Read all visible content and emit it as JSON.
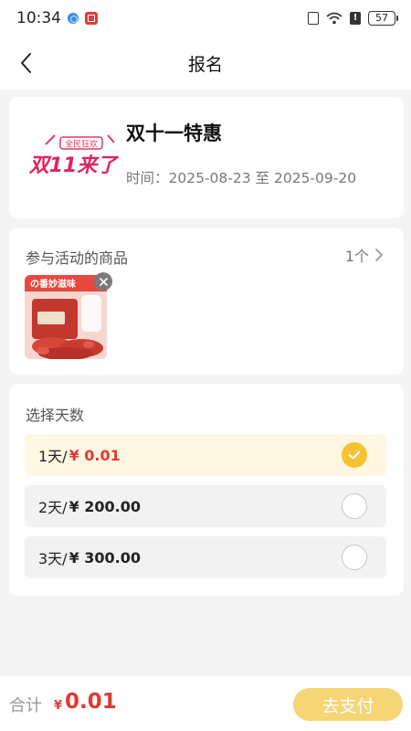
{
  "status_bar": {
    "time": "10:34",
    "battery": "57"
  },
  "nav": {
    "title": "报名"
  },
  "event": {
    "logo_text": "双11来了",
    "logo_badge": "全民狂欢",
    "title": "双十一特惠",
    "time_label": "时间：",
    "start_date": "2025-08-23",
    "to": "至",
    "end_date": "2025-09-20"
  },
  "goods": {
    "title": "参与活动的商品",
    "count": "1个",
    "item_banner": "の番妙滋味"
  },
  "days": {
    "title": "选择天数",
    "options": [
      {
        "label": "1天/",
        "price": "¥ 0.01",
        "selected": true
      },
      {
        "label": "2天/",
        "price": "¥ 200.00",
        "selected": false
      },
      {
        "label": "3天/",
        "price": "¥ 300.00",
        "selected": false
      }
    ]
  },
  "footer": {
    "total_label": "合计",
    "currency": "¥",
    "total": "0.01",
    "pay_button": "去支付"
  },
  "colors": {
    "accent_yellow": "#f5c233",
    "price_red": "#e03a32",
    "selected_bg": "#fff7e2",
    "pay_button_bg": "#f6d576"
  },
  "icons": [
    "back-arrow-icon",
    "chevron-right-icon",
    "close-icon",
    "check-icon",
    "wifi-icon",
    "battery-icon",
    "vibrate-icon"
  ]
}
